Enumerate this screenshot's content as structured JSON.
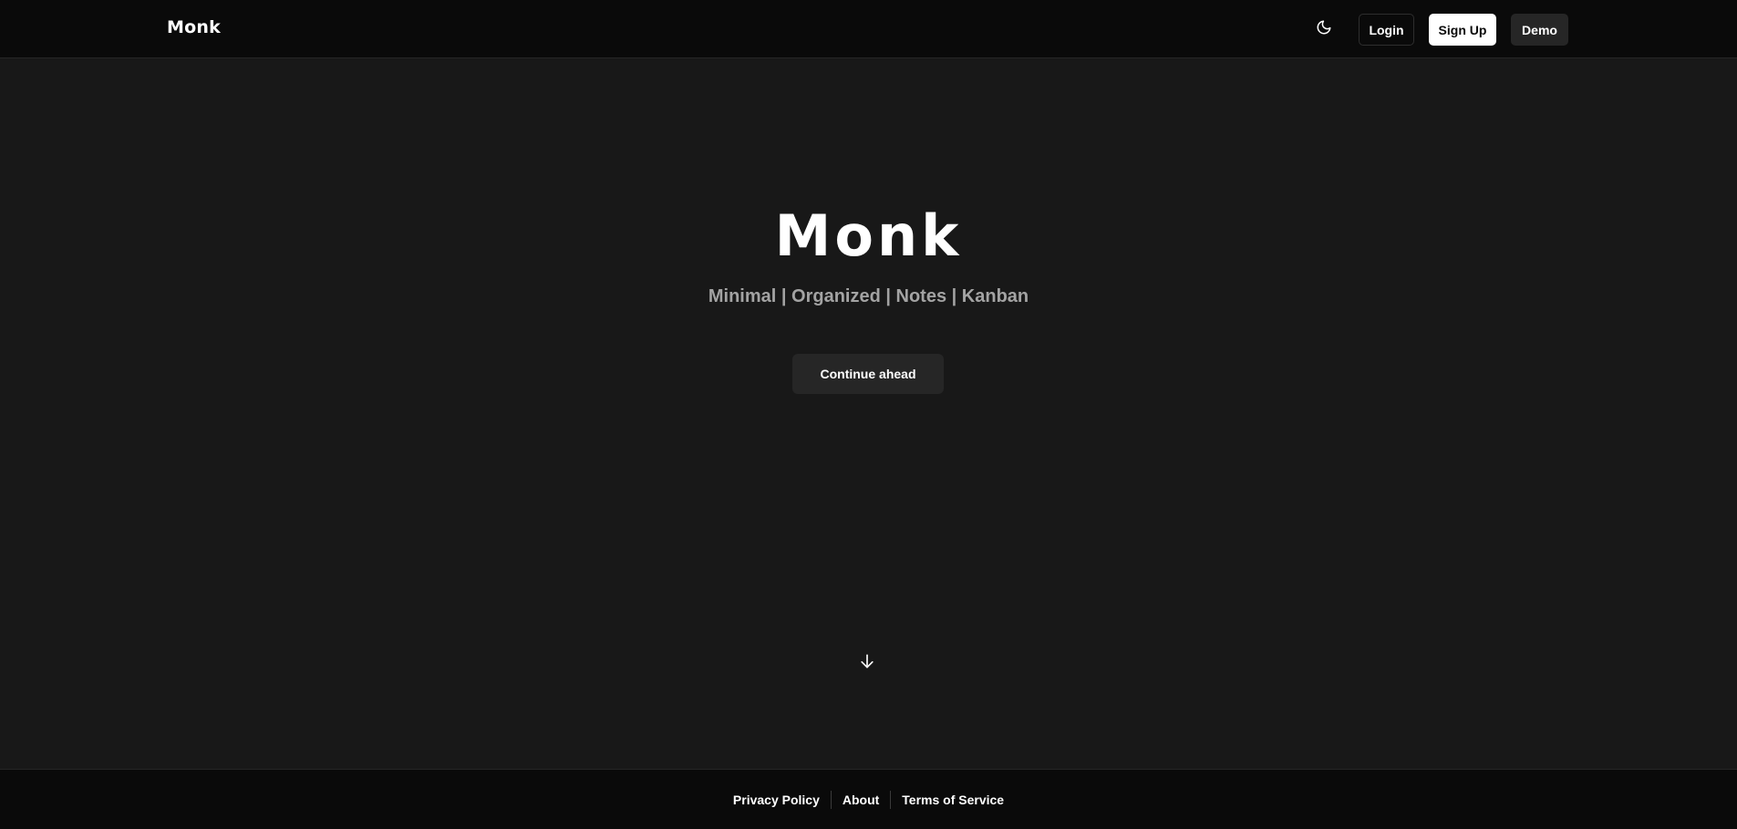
{
  "navbar": {
    "brand": "Monk",
    "theme_icon": "moon-icon",
    "login_label": "Login",
    "signup_label": "Sign Up",
    "demo_label": "Demo"
  },
  "hero": {
    "title": "Monk",
    "subtitle": "Minimal | Organized | Notes | Kanban",
    "cta_label": "Continue ahead",
    "scroll_icon": "arrow-down-icon"
  },
  "footer": {
    "links": [
      {
        "label": "Privacy Policy"
      },
      {
        "label": "About"
      },
      {
        "label": "Terms of Service"
      }
    ]
  },
  "colors": {
    "background": "#181818",
    "navbar_bg": "#0a0a0a",
    "primary_button_bg": "#ffffff",
    "secondary_button_bg": "#262626",
    "subtitle_text": "#a3a3a3"
  }
}
